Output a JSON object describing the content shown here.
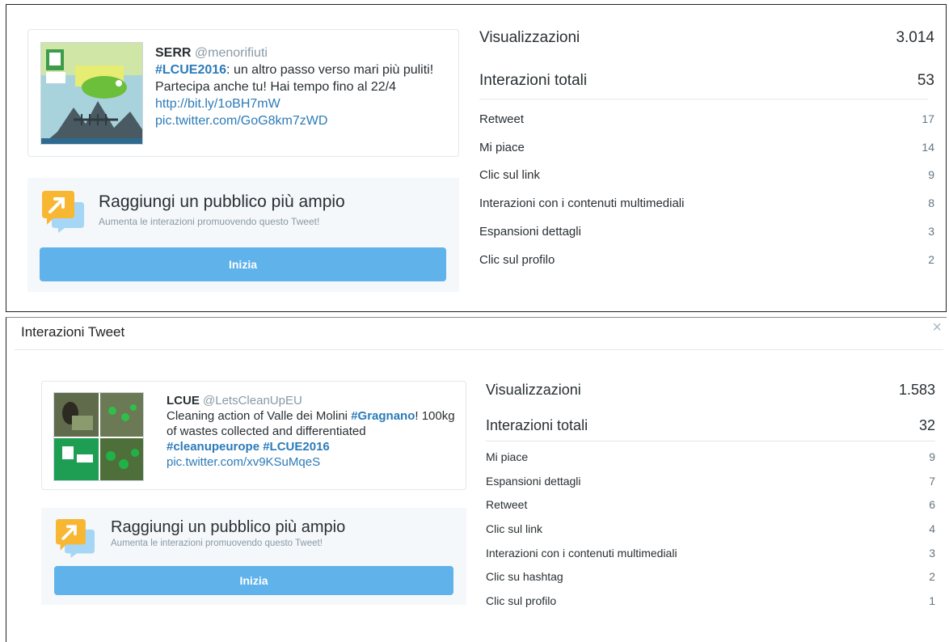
{
  "tweet1": {
    "author": "SERR",
    "handle": "@menorifiuti",
    "hashtag": "#LCUE2016",
    "text_a": ": un altro passo verso mari più puliti! Partecipa anche tu! Hai tempo fino al 22/4 ",
    "link": "http://bit.ly/1oBH7mW",
    "pic": "pic.twitter.com/GoG8km7zWD"
  },
  "promo1": {
    "title": "Raggiungi un pubblico più ampio",
    "subtitle": "Aumenta le interazioni promuovendo questo Tweet!",
    "button": "Inizia"
  },
  "stats1": {
    "views_label": "Visualizzazioni",
    "views_value": "3.014",
    "total_label": "Interazioni totali",
    "total_value": "53",
    "rows": [
      {
        "label": "Retweet",
        "value": "17"
      },
      {
        "label": "Mi piace",
        "value": "14"
      },
      {
        "label": "Clic sul link",
        "value": "9"
      },
      {
        "label": "Interazioni con i contenuti multimediali",
        "value": "8"
      },
      {
        "label": "Espansioni dettagli",
        "value": "3"
      },
      {
        "label": "Clic sul profilo",
        "value": "2"
      }
    ]
  },
  "modal2": {
    "title": "Interazioni Tweet",
    "close": "×"
  },
  "tweet2": {
    "author": "LCUE",
    "handle": "@LetsCleanUpEU",
    "text_a": "Cleaning action of Valle dei Molini ",
    "hashtag1": "#Gragnano",
    "text_b": "! 100kg of wastes collected and differentiated ",
    "hashtag2": "#cleanupeurope",
    "hashtag3": "#LCUE2016",
    "pic": "pic.twitter.com/xv9KSuMqeS"
  },
  "promo2": {
    "title": "Raggiungi un pubblico più ampio",
    "subtitle": "Aumenta le interazioni promuovendo questo Tweet!",
    "button": "Inizia"
  },
  "stats2": {
    "views_label": "Visualizzazioni",
    "views_value": "1.583",
    "total_label": "Interazioni totali",
    "total_value": "32",
    "rows": [
      {
        "label": "Mi piace",
        "value": "9"
      },
      {
        "label": "Espansioni dettagli",
        "value": "7"
      },
      {
        "label": "Retweet",
        "value": "6"
      },
      {
        "label": "Clic sul link",
        "value": "4"
      },
      {
        "label": "Interazioni con i contenuti multimediali",
        "value": "3"
      },
      {
        "label": "Clic su hashtag",
        "value": "2"
      },
      {
        "label": "Clic sul profilo",
        "value": "1"
      }
    ]
  },
  "colors": {
    "link": "#2b7bb9",
    "button": "#5fb2ea",
    "promo_bg": "#f5f8fa",
    "muted": "#8899a6"
  }
}
